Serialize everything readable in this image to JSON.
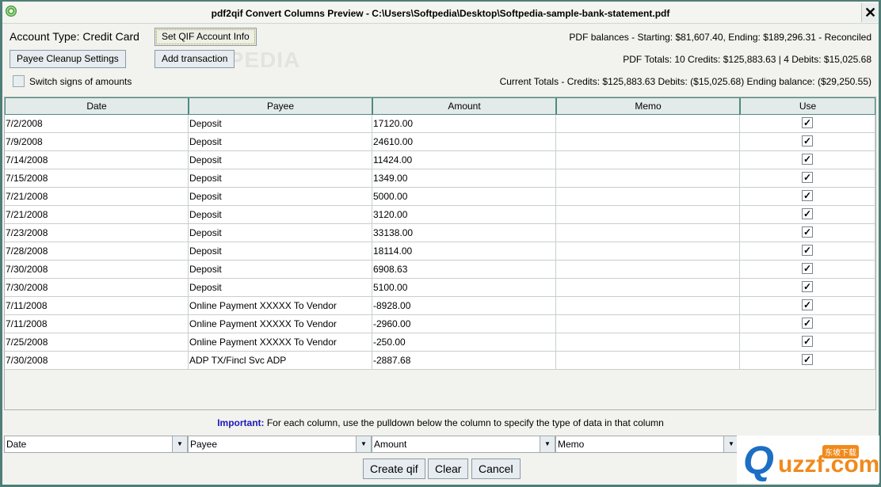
{
  "window": {
    "title": "pdf2qif Convert Columns Preview - C:\\Users\\Softpedia\\Desktop\\Softpedia-sample-bank-statement.pdf",
    "close": "✕"
  },
  "account_type": "Account Type: Credit Card",
  "buttons": {
    "set_qif": "Set QIF Account Info",
    "payee_cleanup": "Payee Cleanup Settings",
    "add_transaction": "Add transaction",
    "create": "Create qif",
    "clear": "Clear",
    "cancel": "Cancel"
  },
  "switch_signs": {
    "label": "Switch signs of amounts",
    "checked": false
  },
  "summary": {
    "balances": "PDF balances - Starting: $81,607.40, Ending: $189,296.31  - Reconciled",
    "pdf_totals": "PDF Totals:  10 Credits: $125,883.63 | 4 Debits: $15,025.68",
    "current_totals": "Current Totals - Credits: $125,883.63  Debits: ($15,025.68)   Ending balance: ($29,250.55)"
  },
  "watermark": "SOFTPEDIA",
  "table": {
    "columns": [
      "Date",
      "Payee",
      "Amount",
      "Memo",
      "Use"
    ],
    "rows": [
      [
        "7/2/2008",
        "Deposit",
        "17120.00",
        "",
        true
      ],
      [
        "7/9/2008",
        "Deposit",
        "24610.00",
        "",
        true
      ],
      [
        "7/14/2008",
        "Deposit",
        "11424.00",
        "",
        true
      ],
      [
        "7/15/2008",
        "Deposit",
        "1349.00",
        "",
        true
      ],
      [
        "7/21/2008",
        "Deposit",
        "5000.00",
        "",
        true
      ],
      [
        "7/21/2008",
        "Deposit",
        "3120.00",
        "",
        true
      ],
      [
        "7/23/2008",
        "Deposit",
        "33138.00",
        "",
        true
      ],
      [
        "7/28/2008",
        "Deposit",
        "18114.00",
        "",
        true
      ],
      [
        "7/30/2008",
        "Deposit",
        "6908.63",
        "",
        true
      ],
      [
        "7/30/2008",
        "Deposit",
        "5100.00",
        "",
        true
      ],
      [
        "7/11/2008",
        "Online Payment XXXXX To Vendor",
        "-8928.00",
        "",
        true
      ],
      [
        "7/11/2008",
        "Online Payment XXXXX To Vendor",
        "-2960.00",
        "",
        true
      ],
      [
        "7/25/2008",
        "Online Payment XXXXX To Vendor",
        "-250.00",
        "",
        true
      ],
      [
        "7/30/2008",
        "ADP TX/Fincl Svc ADP",
        "-2887.68",
        "",
        true
      ]
    ]
  },
  "important": {
    "label": "Important:",
    "text": " For each column, use the pulldown below the column to specify the type of data in that column"
  },
  "column_types": [
    "Date",
    "Payee",
    "Amount",
    "Memo"
  ],
  "logo": {
    "q": "Q",
    "text": "uzzf.com",
    "cn": "东坡下载"
  }
}
